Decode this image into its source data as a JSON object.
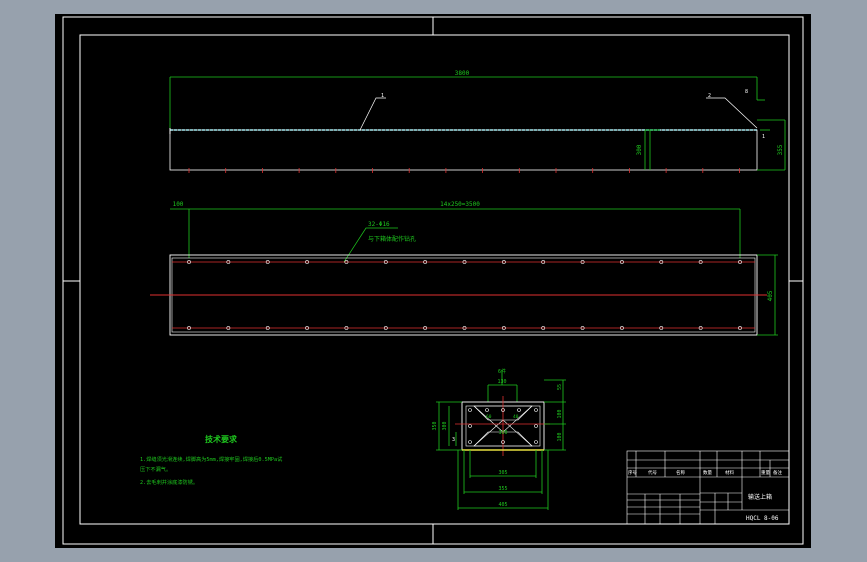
{
  "colors": {
    "background": "#97a1ad",
    "canvas": "#000000",
    "border": "#ffffff",
    "dimension": "#1ec81e",
    "centerline": "#e03030",
    "geometry": "#ffffff",
    "cyan": "#40d0e0",
    "yellow": "#e8e040"
  },
  "top_view": {
    "overall_length": "3800",
    "height_right": "355",
    "height_inner": "300",
    "end_dim": "8",
    "callout_1": "1",
    "callout_2": "2",
    "side_dim": "1"
  },
  "plan_view": {
    "left_offset": "100",
    "pitch_dim": "14x250=3500",
    "hole_spec": "32-Φ16",
    "hole_note": "与下箱体配作钻孔",
    "width_dim": "405"
  },
  "section_view": {
    "top_label": "6件",
    "top_width": "130",
    "right_top": "55",
    "right_mid": "100",
    "right_low": "100",
    "left_outer": "350",
    "left_inner": "300",
    "left_small": "3",
    "inner_width": "300",
    "lower_width": "305",
    "bottom_width": "355",
    "overall_width": "405",
    "label_a": "60",
    "label_b": "40"
  },
  "notes": {
    "title": "技术要求",
    "line1": "1.焊缝须光滑连续,焊脚高为5mm,焊接牢固,焊接后0.5MPa试",
    "line2": "  压下不漏气。",
    "line3": "2.去毛刺并涂底漆防锈。"
  },
  "title_block": {
    "part_name": "输送上箱",
    "drawing_no": "HQCL 8-06",
    "col_seq": "序号",
    "col_code": "代号",
    "col_name": "名称",
    "col_qty": "数量",
    "col_material": "材料",
    "col_weight": "重量",
    "col_remark": "备注"
  }
}
